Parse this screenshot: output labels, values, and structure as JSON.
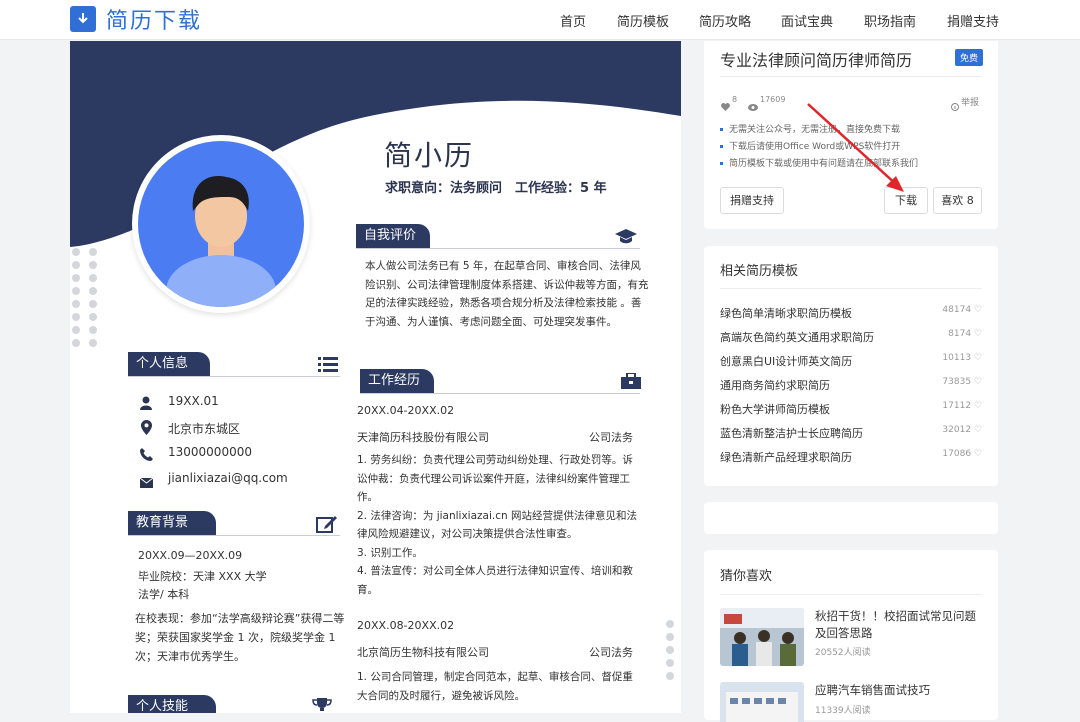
{
  "site": {
    "logo_icon": "download-icon",
    "logo_text": "简历下载"
  },
  "nav": [
    "首页",
    "简历模板",
    "简历攻略",
    "面试宝典",
    "职场指南",
    "捐赠支持"
  ],
  "resume": {
    "name": "简小历",
    "intent": "求职意向：法务顾问　工作经验：5 年",
    "self_eval": {
      "title": "自我评价",
      "text": "本人做公司法务已有 5 年，在起草合同、审核合同、法律风险识别、公司法律管理制度体系搭建、诉讼仲裁等方面，有充足的法律实践经验，熟悉各项合规分析及法律检索技能 。善于沟通、为人谨慎、考虑问题全面、可处理突发事件。"
    },
    "personal": {
      "title": "个人信息",
      "birth": "19XX.01",
      "location": "北京市东城区",
      "phone": "13000000000",
      "email": "jianlixiazai@qq.com"
    },
    "education": {
      "title": "教育背景",
      "period": "20XX.09—20XX.09",
      "school": "毕业院校：天津 XXX 大学",
      "major": "法学/ 本科",
      "perf": "在校表现：参加“法学高级辩论赛”获得二等奖；荣获国家奖学金 1 次，院级奖学金 1 次；天津市优秀学生。"
    },
    "skills": {
      "title": "个人技能"
    },
    "work": {
      "title": "工作经历",
      "jobs": [
        {
          "period": "20XX.04-20XX.02",
          "company": "天津简历科技股份有限公司",
          "role": "公司法务",
          "duties": "1. 劳务纠纷：负责代理公司劳动纠纷处理、行政处罚等。诉讼仲裁：负责代理公司诉讼案件开庭，法律纠纷案件管理工作。\n2. 法律咨询：为 jianlixiazai.cn 网站经营提供法律意见和法律风险规避建议，对公司决策提供合法性审查。\n3. 识别工作。\n4. 普法宣传：对公司全体人员进行法律知识宣传、培训和教育。"
        },
        {
          "period": "20XX.08-20XX.02",
          "company": "北京简历生物科技有限公司",
          "role": "公司法务",
          "duties": "1. 公司合同管理，制定合同范本，起草、审核合同、督促重大合同的及时履行，避免被诉风险。"
        }
      ]
    }
  },
  "detail": {
    "title": "专业法律顾问简历律师简历",
    "badge": "免费",
    "likes": "8",
    "views": "17609",
    "report": "举报",
    "bullets": [
      "无需关注公众号，无需注册，直接免费下载",
      "下载后请使用Office Word或WPS软件打开",
      "简历模板下载或使用中有问题请在底部联系我们"
    ],
    "donate_label": "捐赠支持",
    "download_label": "下载",
    "like_label": "喜欢 8"
  },
  "related": {
    "title": "相关简历模板",
    "items": [
      {
        "name": "绿色简单清晰求职简历模板",
        "count": "48174"
      },
      {
        "name": "高端灰色简约英文通用求职简历",
        "count": "8174"
      },
      {
        "name": "创意黑白UI设计师英文简历",
        "count": "10113"
      },
      {
        "name": "通用商务简约求职简历",
        "count": "73835"
      },
      {
        "name": "粉色大学讲师简历模板",
        "count": "17112"
      },
      {
        "name": "蓝色清新整洁护士长应聘简历",
        "count": "32012"
      },
      {
        "name": "绿色清新产品经理求职简历",
        "count": "17086"
      }
    ]
  },
  "guess": {
    "title": "猜你喜欢",
    "items": [
      {
        "title": "秋招干货！！校招面试常见问题及回答思路",
        "reads": "20552人阅读"
      },
      {
        "title": "应聘汽车销售面试技巧",
        "reads": "11339人阅读"
      }
    ]
  },
  "colors": {
    "brand": "#2f6fd6",
    "resume_navy": "#2c3a62",
    "avatar_blue": "#4b7cf2",
    "arrow_red": "#e0252b"
  }
}
